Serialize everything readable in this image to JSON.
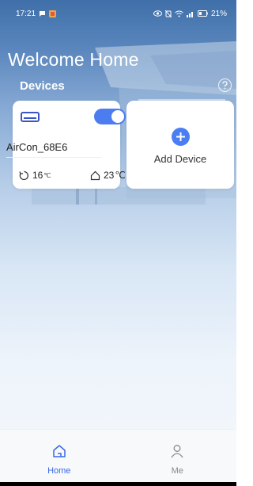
{
  "status_bar": {
    "time": "17:21",
    "battery": "21%"
  },
  "header": {
    "title": "Welcome Home",
    "section_title": "Devices"
  },
  "devices": [
    {
      "name": "AirCon_68E6",
      "power_on": true,
      "set_temp": "16",
      "room_temp": "23",
      "unit": "℃"
    }
  ],
  "add_device": {
    "label": "Add Device"
  },
  "tabs": [
    {
      "label": "Home",
      "active": true
    },
    {
      "label": "Me",
      "active": false
    }
  ],
  "colors": {
    "accent": "#4a7ef2",
    "active_tab": "#3a68e6"
  }
}
